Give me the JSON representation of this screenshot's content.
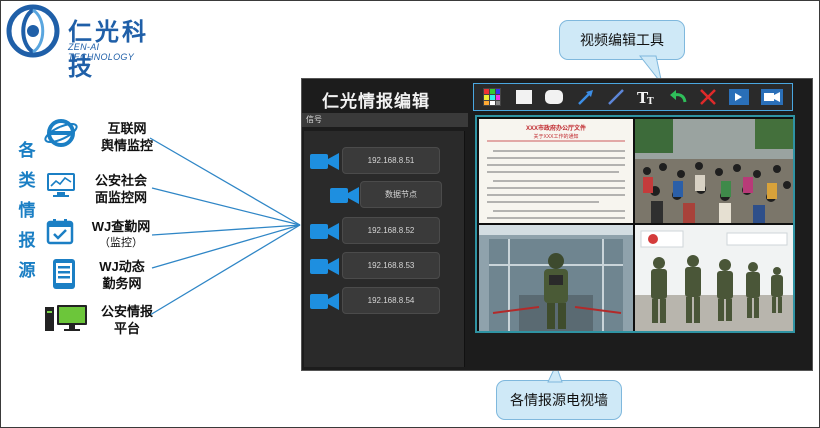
{
  "logo": {
    "name": "仁光科技",
    "tagline": "ZEN-AI TECHNOLOGY"
  },
  "left_caption": [
    "各",
    "类",
    "情",
    "报",
    "源"
  ],
  "sources": [
    {
      "line1": "互联网",
      "line2": "舆情监控",
      "icon": "internet-explorer-icon"
    },
    {
      "line1": "公安社会",
      "line2": "面监控网",
      "icon": "monitor-chart-icon"
    },
    {
      "line1": "WJ查勤网",
      "line2": "（监控）",
      "icon": "calendar-check-icon"
    },
    {
      "line1": "WJ动态",
      "line2": "勤务网",
      "icon": "mobile-grid-icon"
    },
    {
      "line1": "公安情报",
      "line2": "平台",
      "icon": "computer-icon"
    }
  ],
  "callouts": {
    "toolbar": "视频编辑工具",
    "wall": "各情报源电视墙"
  },
  "app": {
    "title": "仁光情报编辑",
    "signal_header": "信号",
    "signals": [
      {
        "label": "192.168.8.51"
      },
      {
        "label": "数据节点"
      },
      {
        "label": "192.168.8.52"
      },
      {
        "label": "192.168.8.53"
      },
      {
        "label": "192.168.8.54"
      }
    ],
    "toolbar_tools": [
      "color-palette-icon",
      "rectangle-icon",
      "rounded-rect-icon",
      "arrow-icon",
      "pen-icon",
      "text-icon",
      "undo-icon",
      "delete-icon",
      "record-icon",
      "camera-icon"
    ],
    "wall_cells": [
      "document-feed",
      "crowd-feed",
      "guard-feed",
      "patrol-feed"
    ],
    "document": {
      "title": "XXX市政府办公厅文件",
      "subtitle": "关于XXX工作的通知"
    }
  },
  "colors": {
    "accent": "#1b7fc4",
    "bubble": "#cfe9f7",
    "wall_border": "#2f93a3",
    "toolbar_border": "#4aa7e0"
  }
}
